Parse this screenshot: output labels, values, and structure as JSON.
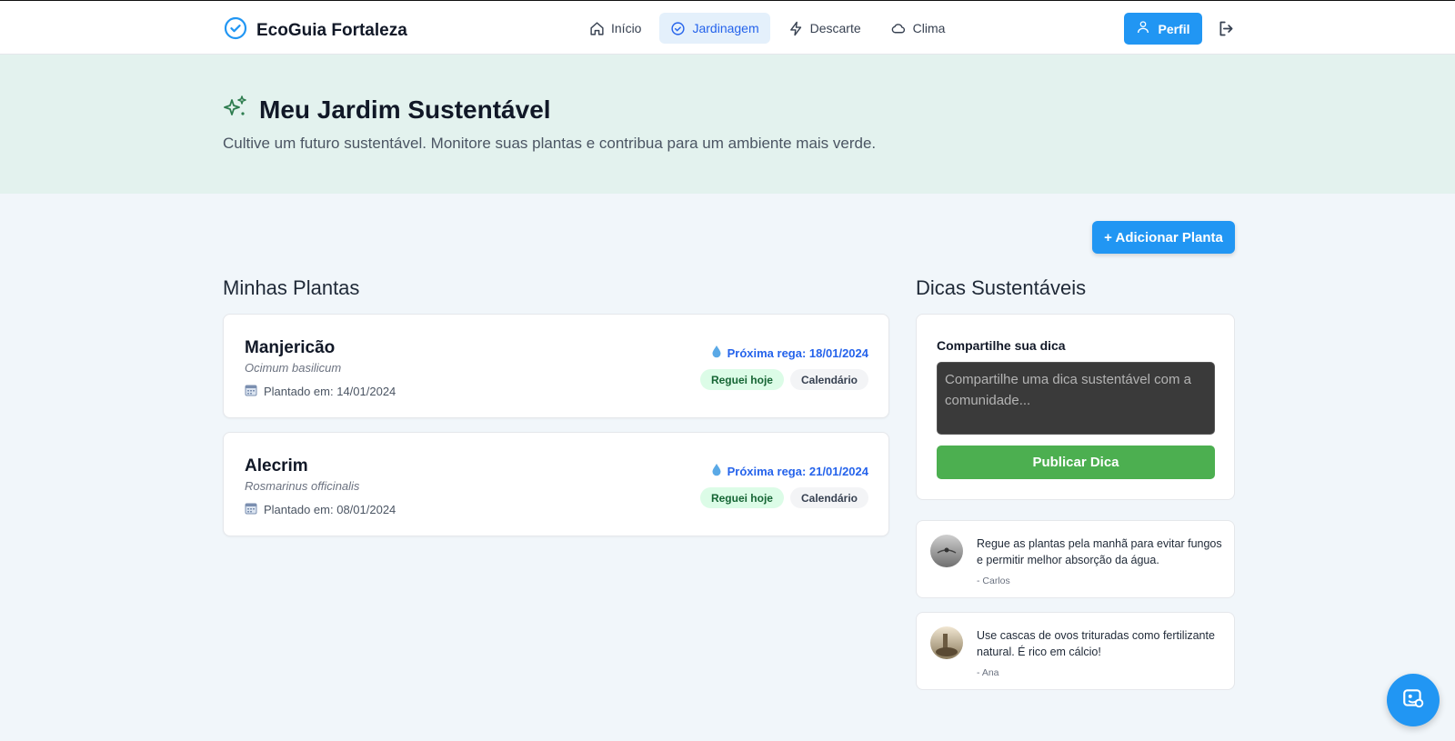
{
  "brand": {
    "name": "EcoGuia Fortaleza",
    "icon": "check-circle-icon"
  },
  "nav": {
    "items": [
      {
        "label": "Início",
        "icon": "home-icon",
        "active": false
      },
      {
        "label": "Jardinagem",
        "icon": "check-circle-icon",
        "active": true
      },
      {
        "label": "Descarte",
        "icon": "lightning-icon",
        "active": false
      },
      {
        "label": "Clima",
        "icon": "cloud-icon",
        "active": false
      }
    ],
    "profile_label": "Perfil",
    "logout_icon": "logout-icon"
  },
  "hero": {
    "title": "Meu Jardim Sustentável",
    "subtitle": "Cultive um futuro sustentável. Monitore suas plantas e contribua para um ambiente mais verde.",
    "icon": "sparkles-icon"
  },
  "actions": {
    "add_plant": "+ Adicionar Planta"
  },
  "plants_section": {
    "title": "Minhas Plantas",
    "plants": [
      {
        "name": "Manjericão",
        "scientific": "Ocimum basilicum",
        "planted": "Plantado em: 14/01/2024",
        "next_water": "Próxima rega: 18/01/2024",
        "watered_label": "Reguei hoje",
        "calendar_label": "Calendário"
      },
      {
        "name": "Alecrim",
        "scientific": "Rosmarinus officinalis",
        "planted": "Plantado em: 08/01/2024",
        "next_water": "Próxima rega: 21/01/2024",
        "watered_label": "Reguei hoje",
        "calendar_label": "Calendário"
      }
    ]
  },
  "tips_section": {
    "title": "Dicas Sustentáveis",
    "form": {
      "title": "Compartilhe sua dica",
      "placeholder": "Compartilhe uma dica sustentável com a comunidade...",
      "publish_label": "Publicar Dica"
    },
    "tips": [
      {
        "text": "Regue as plantas pela manhã para evitar fungos e permitir melhor absorção da água.",
        "author": "- Carlos"
      },
      {
        "text": "Use cascas de ovos trituradas como fertilizante natural. É rico em cálcio!",
        "author": "- Ana"
      }
    ]
  },
  "colors": {
    "primary": "#2196f3",
    "success": "#4caf50",
    "hero_bg": "#e3f2ee",
    "page_bg": "#f1f6fa"
  }
}
